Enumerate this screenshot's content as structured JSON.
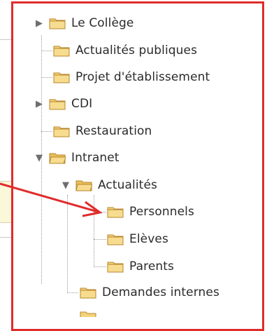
{
  "tree": {
    "items": [
      {
        "label": "Le Collège",
        "toggle": "▶"
      },
      {
        "label": "Actualités publiques",
        "toggle": ""
      },
      {
        "label": "Projet d'établissement",
        "toggle": ""
      },
      {
        "label": "CDI",
        "toggle": "▶"
      },
      {
        "label": "Restauration",
        "toggle": ""
      },
      {
        "label": "Intranet",
        "toggle": "▼"
      },
      {
        "label": "Actualités",
        "toggle": "▼"
      },
      {
        "label": "Personnels",
        "toggle": ""
      },
      {
        "label": "Elèves",
        "toggle": ""
      },
      {
        "label": "Parents",
        "toggle": ""
      },
      {
        "label": "Demandes internes",
        "toggle": ""
      }
    ]
  },
  "colors": {
    "frame": "#e02b2b",
    "folder_fill": "#f3d27a",
    "folder_stroke": "#b8862b"
  }
}
